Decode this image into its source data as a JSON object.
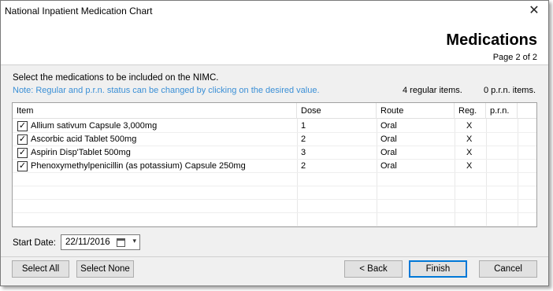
{
  "window": {
    "title": "National Inpatient Medication Chart",
    "close_glyph": "✕"
  },
  "header": {
    "title": "Medications",
    "page": "Page 2 of 2"
  },
  "instruction": "Select the medications to be included on the NIMC.",
  "note": "Note: Regular and p.r.n. status can be changed by clicking on the desired value.",
  "counts": {
    "regular": "4 regular items.",
    "prn": "0 p.r.n. items."
  },
  "grid": {
    "columns": [
      "Item",
      "Dose",
      "Route",
      "Reg.",
      "p.r.n."
    ],
    "rows": [
      {
        "checked": "✓",
        "item": "Allium sativum Capsule 3,000mg",
        "dose": "1",
        "route": "Oral",
        "reg": "X",
        "prn": ""
      },
      {
        "checked": "✓",
        "item": "Ascorbic acid Tablet 500mg",
        "dose": "2",
        "route": "Oral",
        "reg": "X",
        "prn": ""
      },
      {
        "checked": "✓",
        "item": "Aspirin Disp'Tablet 500mg",
        "dose": "3",
        "route": "Oral",
        "reg": "X",
        "prn": ""
      },
      {
        "checked": "✓",
        "item": "Phenoxymethylpenicillin (as potassium) Capsule 250mg",
        "dose": "2",
        "route": "Oral",
        "reg": "X",
        "prn": ""
      }
    ]
  },
  "start_date": {
    "label": "Start Date:",
    "value": "22/11/2016",
    "arrow": "▾"
  },
  "buttons": {
    "select_all": "Select All",
    "select_none": "Select None",
    "back": "< Back",
    "finish": "Finish",
    "cancel": "Cancel"
  }
}
